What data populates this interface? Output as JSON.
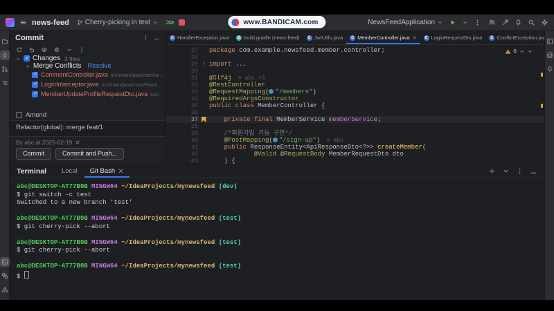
{
  "colors": {
    "accent": "#3574f0",
    "conflict_red": "#d5756c",
    "keyword_orange": "#cf8e6d",
    "annotation_olive": "#b3ae60",
    "string_green": "#6aab73",
    "field_purple": "#c77dbb",
    "terminal_green": "#4ece58",
    "terminal_magenta": "#c678dd",
    "terminal_yellow": "#d7ba7d",
    "terminal_cyan": "#4fd6be"
  },
  "watermark": {
    "text": "www.BANDICAM.com"
  },
  "titlebar": {
    "project": "news-feed",
    "branch": "Cherry-picking in test",
    "resume_label": ">>",
    "run_config": "NewsFeedApplication",
    "right_icons": [
      "users",
      "wrench",
      "bell",
      "search",
      "settings"
    ]
  },
  "left_strip": {
    "top": [
      {
        "icon": "folder"
      },
      {
        "icon": "commit",
        "active": true
      },
      {
        "icon": "pull-request"
      },
      {
        "icon": "structure"
      }
    ],
    "bottom": [
      {
        "icon": "terminal",
        "active": true
      },
      {
        "icon": "services"
      },
      {
        "icon": "problems"
      }
    ]
  },
  "right_strip": {
    "icons": [
      {
        "icon": "layout"
      },
      {
        "icon": "database"
      },
      {
        "icon": "bell"
      }
    ]
  },
  "commit_panel": {
    "title": "Commit",
    "header_icons": [
      "more",
      "minimize"
    ],
    "toolbar_icons": [
      "refresh",
      "rollback",
      "eye",
      "settings",
      "chevron-down",
      "more"
    ],
    "changes_label": "Changes",
    "changes_count": "3 files",
    "group_label": "Merge Conflicts",
    "resolve_link": "Resolve",
    "files": [
      {
        "name": "CommentController.java",
        "path": "src/main/java/com/example/newsfeed/comment/controller"
      },
      {
        "name": "LoginInterceptor.java",
        "path": "src/main/java/com/example/newsfeed/global/interceptor"
      },
      {
        "name": "MemberUpdateProfileRequestDto.java",
        "path": "src/main/java/com/example/newsfeed/member/dto"
      }
    ],
    "amend_label": "Amend",
    "message": "Refactor(global): merge feat/1",
    "author_line": "By abc at 2025-02-19",
    "buttons": {
      "commit": "Commit",
      "commit_push": "Commit and Push..."
    }
  },
  "editor": {
    "tabs": [
      {
        "label": "HandlerException.java",
        "icon": "class"
      },
      {
        "label": "build.gradle (news-feed)",
        "icon": "gradle"
      },
      {
        "label": "JwtUtils.java",
        "icon": "class"
      },
      {
        "label": "MemberController.java",
        "icon": "class",
        "active": true,
        "close": true
      },
      {
        "label": "LoginRequestDto.java",
        "icon": "class"
      },
      {
        "label": "ConflictException.java",
        "icon": "class"
      }
    ],
    "inspections": {
      "warning_count": "6"
    },
    "lines": [
      {
        "n": "27",
        "segs": [
          [
            "k",
            "package "
          ],
          [
            "d",
            "com.example.newsfeed.member.controller;"
          ]
        ]
      },
      {
        "n": "28",
        "segs": []
      },
      {
        "n": "29",
        "fold": true,
        "segs": [
          [
            "k",
            "import "
          ],
          [
            "d",
            "..."
          ]
        ]
      },
      {
        "n": "30",
        "segs": []
      },
      {
        "n": "31",
        "segs": [
          [
            "a",
            "@Slf4j"
          ],
          [
            "h",
            "  ≡ abc +3"
          ]
        ]
      },
      {
        "n": "32",
        "segs": [
          [
            "a",
            "@RestController"
          ]
        ]
      },
      {
        "n": "33",
        "segs": [
          [
            "a",
            "@RequestMapping"
          ],
          [
            "d",
            "("
          ],
          [
            "ic",
            ""
          ],
          [
            "s",
            "\"/members\""
          ],
          [
            "d",
            ")"
          ]
        ]
      },
      {
        "n": "34",
        "segs": [
          [
            "a",
            "@RequiredArgsConstructor"
          ]
        ]
      },
      {
        "n": "35",
        "segs": [
          [
            "k",
            "public class "
          ],
          [
            "d",
            "MemberController {"
          ]
        ]
      },
      {
        "n": "36",
        "segs": []
      },
      {
        "n": "37",
        "cur": true,
        "bookmark": true,
        "segs": [
          [
            "d",
            "    "
          ],
          [
            "k",
            "private final "
          ],
          [
            "d",
            "MemberService "
          ],
          [
            "f",
            "memberService"
          ],
          [
            "d",
            ";"
          ]
        ]
      },
      {
        "n": "38",
        "segs": []
      },
      {
        "n": "39",
        "segs": [
          [
            "d",
            "    "
          ],
          [
            "c",
            "/*회원가입 기능 구현*/"
          ]
        ]
      },
      {
        "n": "40",
        "segs": [
          [
            "d",
            "    "
          ],
          [
            "a",
            "@PostMapping"
          ],
          [
            "d",
            "("
          ],
          [
            "ic",
            ""
          ],
          [
            "s",
            "\"/sign-up\""
          ],
          [
            "d",
            ")"
          ],
          [
            "h",
            "  ≡ abc"
          ]
        ]
      },
      {
        "n": "41",
        "segs": [
          [
            "d",
            "    "
          ],
          [
            "k",
            "public "
          ],
          [
            "d",
            "ResponseEntity<ApiResponseDto<?>> "
          ],
          [
            "m",
            "createMember"
          ],
          [
            "d",
            "("
          ]
        ]
      },
      {
        "n": "42",
        "segs": [
          [
            "d",
            "            "
          ],
          [
            "a",
            "@Valid "
          ],
          [
            "a",
            "@RequestBody "
          ],
          [
            "d",
            "MemberRequestDto dto"
          ]
        ]
      },
      {
        "n": "43",
        "segs": [
          [
            "d",
            "    ) {"
          ]
        ]
      }
    ]
  },
  "terminal": {
    "title": "Terminal",
    "tabs": [
      {
        "label": "Local"
      },
      {
        "label": "Git Bash",
        "active": true,
        "close": true
      }
    ],
    "header_icons": [
      "plus",
      "chevron-down",
      "more",
      "minimize"
    ],
    "lines": [
      {
        "segs": [
          [
            "tg",
            "abc@DESKTOP-AT77B9B "
          ],
          [
            "tm",
            "MINGW64 "
          ],
          [
            "ty",
            "~/IdeaProjects/mynewsfeed "
          ],
          [
            "tc",
            "(dev)"
          ]
        ]
      },
      {
        "segs": [
          [
            "td",
            "$ git switch -c test"
          ]
        ]
      },
      {
        "segs": [
          [
            "td",
            "Switched to a new branch 'test'"
          ]
        ]
      },
      {
        "segs": []
      },
      {
        "segs": [
          [
            "tg",
            "abc@DESKTOP-AT77B9B "
          ],
          [
            "tm",
            "MINGW64 "
          ],
          [
            "ty",
            "~/IdeaProjects/mynewsfeed "
          ],
          [
            "tc",
            "(test)"
          ]
        ]
      },
      {
        "segs": [
          [
            "td",
            "$ git cherry-pick --abort"
          ]
        ]
      },
      {
        "segs": []
      },
      {
        "segs": [
          [
            "tg",
            "abc@DESKTOP-AT77B9B "
          ],
          [
            "tm",
            "MINGW64 "
          ],
          [
            "ty",
            "~/IdeaProjects/mynewsfeed "
          ],
          [
            "tc",
            "(test)"
          ]
        ]
      },
      {
        "segs": [
          [
            "td",
            "$ git cherry-pick --abort"
          ]
        ]
      },
      {
        "segs": []
      },
      {
        "segs": [
          [
            "tg",
            "abc@DESKTOP-AT77B9B "
          ],
          [
            "tm",
            "MINGW64 "
          ],
          [
            "ty",
            "~/IdeaProjects/mynewsfeed "
          ],
          [
            "tc",
            "(test)"
          ]
        ]
      },
      {
        "segs": [
          [
            "td",
            "$ "
          ],
          [
            "cursor",
            ""
          ]
        ]
      }
    ]
  }
}
